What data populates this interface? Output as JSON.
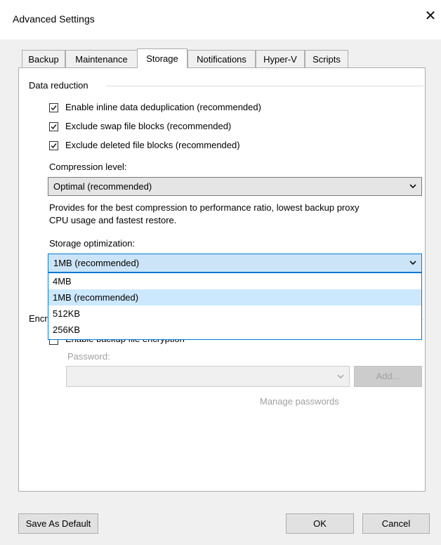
{
  "window": {
    "title": "Advanced Settings",
    "close_glyph": "✕"
  },
  "tabs": [
    {
      "label": "Backup",
      "active": false
    },
    {
      "label": "Maintenance",
      "active": false
    },
    {
      "label": "Storage",
      "active": true
    },
    {
      "label": "Notifications",
      "active": false
    },
    {
      "label": "Hyper-V",
      "active": false
    },
    {
      "label": "Scripts",
      "active": false
    }
  ],
  "data_reduction": {
    "section_title": "Data reduction",
    "checkboxes": [
      {
        "label": "Enable inline data deduplication (recommended)",
        "checked": true
      },
      {
        "label": "Exclude swap file blocks (recommended)",
        "checked": true
      },
      {
        "label": "Exclude deleted file blocks (recommended)",
        "checked": true
      }
    ],
    "compression_label": "Compression level:",
    "compression_value": "Optimal (recommended)",
    "compression_desc_1": "Provides for the best compression to performance ratio, lowest backup proxy",
    "compression_desc_2": "CPU usage and fastest restore.",
    "storage_opt_label": "Storage optimization:",
    "storage_opt_value": "1MB (recommended)",
    "storage_opt_options": [
      "4MB",
      "1MB (recommended)",
      "512KB",
      "256KB"
    ],
    "storage_opt_selected_index": 1
  },
  "encryption": {
    "section_title": "Encryption",
    "enable_label": "Enable backup file encryption",
    "enable_checked": false,
    "password_label": "Password:",
    "password_value": "",
    "add_button": "Add...",
    "manage_link": "Manage passwords"
  },
  "footer": {
    "save_default": "Save As Default",
    "ok": "OK",
    "cancel": "Cancel"
  }
}
